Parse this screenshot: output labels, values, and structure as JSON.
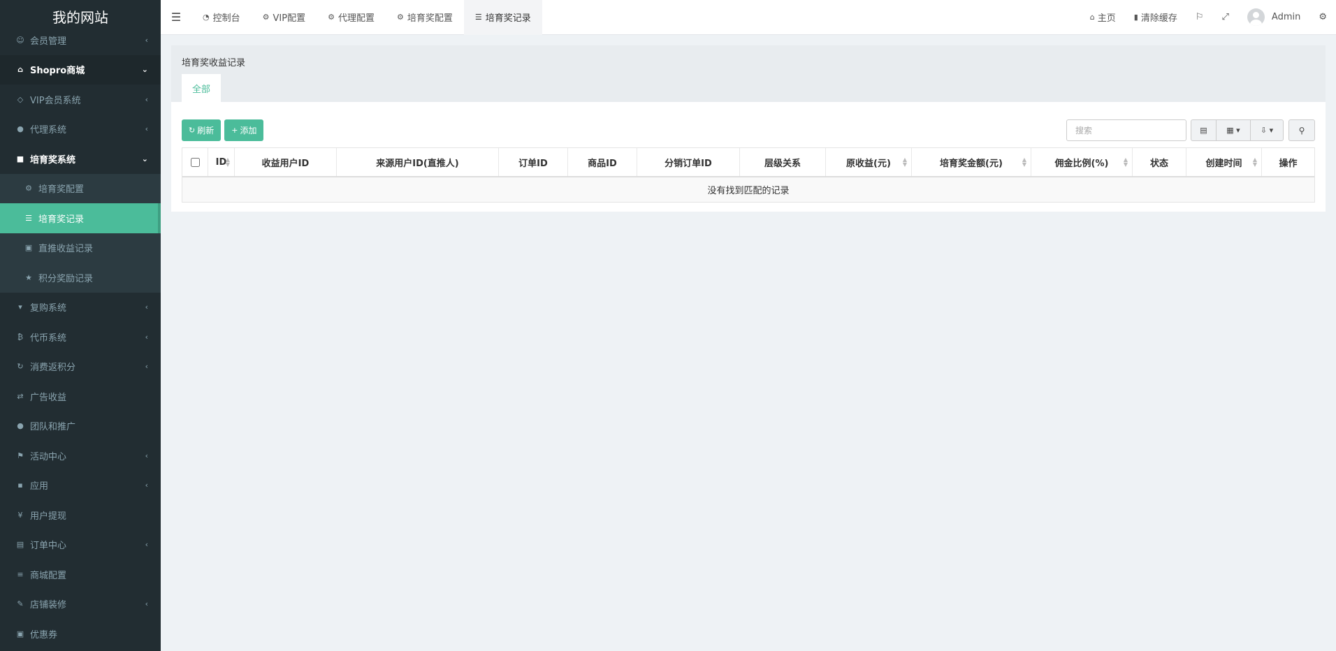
{
  "brand": "我的网站",
  "sidebar": {
    "items": [
      {
        "label": "会员管理",
        "icon": "smile-icon",
        "arrow": "‹"
      },
      {
        "label": "Shopro商城",
        "icon": "home-icon",
        "arrow": "⌄"
      },
      {
        "label": "VIP会员系统",
        "icon": "diamond-icon",
        "arrow": "‹"
      },
      {
        "label": "代理系统",
        "icon": "users-icon",
        "arrow": "‹"
      },
      {
        "label": "培育奖系统",
        "icon": "gift-icon",
        "arrow": "⌄"
      },
      {
        "label": "培育奖配置",
        "icon": "gear-icon"
      },
      {
        "label": "培育奖记录",
        "icon": "list-icon"
      },
      {
        "label": "直推收益记录",
        "icon": "money-icon"
      },
      {
        "label": "积分奖励记录",
        "icon": "star-icon"
      },
      {
        "label": "复购系统",
        "icon": "cart-icon",
        "arrow": "‹"
      },
      {
        "label": "代币系统",
        "icon": "bitcoin-icon",
        "arrow": "‹"
      },
      {
        "label": "消费返积分",
        "icon": "refresh-icon",
        "arrow": "‹"
      },
      {
        "label": "广告收益",
        "icon": "exchange-icon"
      },
      {
        "label": "团队和推广",
        "icon": "users-icon"
      },
      {
        "label": "活动中心",
        "icon": "flag-icon",
        "arrow": "‹"
      },
      {
        "label": "应用",
        "icon": "briefcase-icon",
        "arrow": "‹"
      },
      {
        "label": "用户提现",
        "icon": "yen-icon"
      },
      {
        "label": "订单中心",
        "icon": "file-icon",
        "arrow": "‹"
      },
      {
        "label": "商城配置",
        "icon": "sliders-icon"
      },
      {
        "label": "店铺装修",
        "icon": "brush-icon",
        "arrow": "‹"
      },
      {
        "label": "优惠券",
        "icon": "money-icon"
      }
    ]
  },
  "navbar": {
    "tabs": [
      {
        "label": "控制台",
        "icon": "dashboard-icon"
      },
      {
        "label": "VIP配置",
        "icon": "gear-icon"
      },
      {
        "label": "代理配置",
        "icon": "gear-icon"
      },
      {
        "label": "培育奖配置",
        "icon": "gear-icon"
      },
      {
        "label": "培育奖记录",
        "icon": "list-icon"
      }
    ],
    "home": "主页",
    "clear_cache": "清除缓存",
    "user": "Admin"
  },
  "panel": {
    "title": "培育奖收益记录",
    "tab_all": "全部",
    "refresh": "刷新",
    "add": "添加",
    "search_placeholder": "搜索"
  },
  "table": {
    "columns": [
      "ID",
      "收益用户ID",
      "来源用户ID(直推人)",
      "订单ID",
      "商品ID",
      "分销订单ID",
      "层级关系",
      "原收益(元)",
      "培育奖金额(元)",
      "佣金比例(%)",
      "状态",
      "创建时间",
      "操作"
    ],
    "empty_text": "没有找到匹配的记录"
  },
  "colors": {
    "accent": "#4bbc9a",
    "sidebar_bg": "#222d32"
  }
}
